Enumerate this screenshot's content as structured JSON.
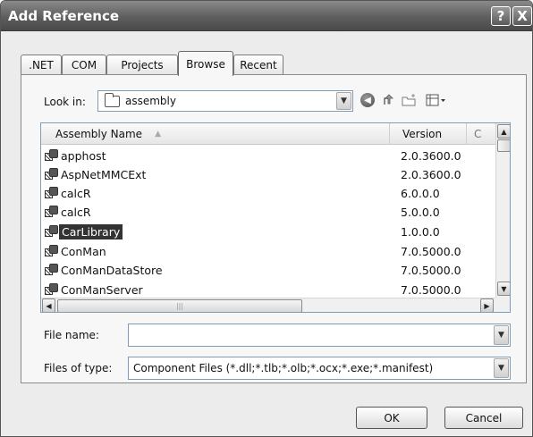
{
  "window": {
    "title": "Add Reference",
    "help_glyph": "?",
    "close_glyph": "X"
  },
  "tabs": [
    {
      "label": ".NET"
    },
    {
      "label": "COM"
    },
    {
      "label": "Projects"
    },
    {
      "label": "Browse",
      "active": true
    },
    {
      "label": "Recent"
    }
  ],
  "look_in": {
    "label": "Look in:",
    "value": "assembly"
  },
  "toolbar": {
    "back_icon": "back-arrow-icon",
    "up_icon": "up-folder-icon",
    "new_folder_icon": "new-folder-icon",
    "views_icon": "views-menu-icon"
  },
  "list": {
    "columns": {
      "name": "Assembly Name",
      "version": "Version",
      "extra": "C"
    },
    "rows": [
      {
        "name": "apphost",
        "version": "2.0.3600.0"
      },
      {
        "name": "AspNetMMCExt",
        "version": "2.0.3600.0"
      },
      {
        "name": "calcR",
        "version": "6.0.0.0"
      },
      {
        "name": "calcR",
        "version": "5.0.0.0"
      },
      {
        "name": "CarLibrary",
        "version": "1.0.0.0",
        "selected": true
      },
      {
        "name": "ConMan",
        "version": "7.0.5000.0"
      },
      {
        "name": "ConManDataStore",
        "version": "7.0.5000.0"
      },
      {
        "name": "ConManServer",
        "version": "7.0.5000.0"
      }
    ]
  },
  "file_name": {
    "label": "File name:",
    "value": ""
  },
  "files_of_type": {
    "label": "Files of type:",
    "value": "Component Files (*.dll;*.tlb;*.olb;*.ocx;*.exe;*.manifest)"
  },
  "buttons": {
    "ok": "OK",
    "cancel": "Cancel"
  },
  "colors": {
    "titlebar": "#5e5e5e",
    "selection": "#333333"
  }
}
